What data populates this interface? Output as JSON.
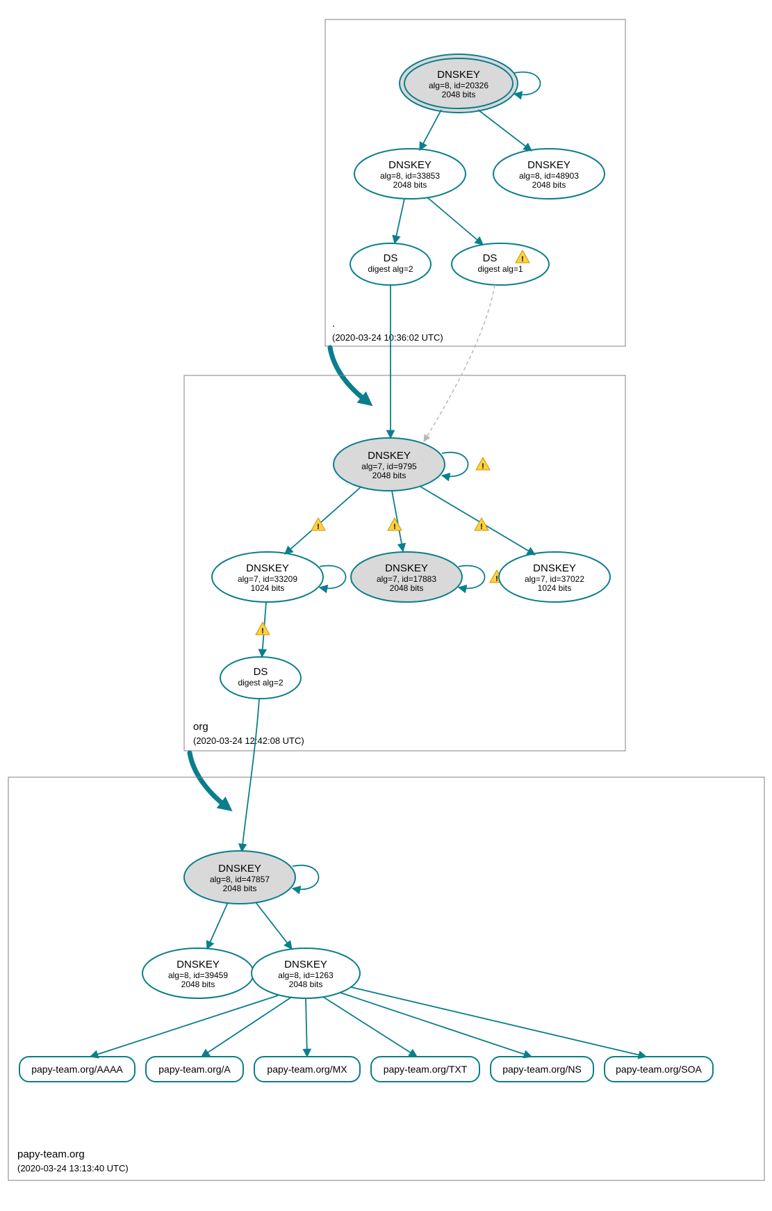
{
  "colors": {
    "teal": "#0a7e8c",
    "gray_fill": "#d9d9d9",
    "white": "#ffffff"
  },
  "zones": {
    "root": {
      "label": ".",
      "timestamp": "(2020-03-24 10:36:02 UTC)"
    },
    "org": {
      "label": "org",
      "timestamp": "(2020-03-24 12:42:08 UTC)"
    },
    "domain": {
      "label": "papy-team.org",
      "timestamp": "(2020-03-24 13:13:40 UTC)"
    }
  },
  "nodes": {
    "root_ksk": {
      "title": "DNSKEY",
      "line1": "alg=8, id=20326",
      "line2": "2048 bits"
    },
    "root_zsk1": {
      "title": "DNSKEY",
      "line1": "alg=8, id=33853",
      "line2": "2048 bits"
    },
    "root_zsk2": {
      "title": "DNSKEY",
      "line1": "alg=8, id=48903",
      "line2": "2048 bits"
    },
    "root_ds2": {
      "title": "DS",
      "line1": "digest alg=2"
    },
    "root_ds1": {
      "title": "DS",
      "line1": "digest alg=1"
    },
    "org_ksk": {
      "title": "DNSKEY",
      "line1": "alg=7, id=9795",
      "line2": "2048 bits"
    },
    "org_k1": {
      "title": "DNSKEY",
      "line1": "alg=7, id=33209",
      "line2": "1024 bits"
    },
    "org_k2": {
      "title": "DNSKEY",
      "line1": "alg=7, id=17883",
      "line2": "2048 bits"
    },
    "org_k3": {
      "title": "DNSKEY",
      "line1": "alg=7, id=37022",
      "line2": "1024 bits"
    },
    "org_ds": {
      "title": "DS",
      "line1": "digest alg=2"
    },
    "dom_ksk": {
      "title": "DNSKEY",
      "line1": "alg=8, id=47857",
      "line2": "2048 bits"
    },
    "dom_k1": {
      "title": "DNSKEY",
      "line1": "alg=8, id=39459",
      "line2": "2048 bits"
    },
    "dom_k2": {
      "title": "DNSKEY",
      "line1": "alg=8, id=1263",
      "line2": "2048 bits"
    }
  },
  "rrsets": {
    "aaaa": "papy-team.org/AAAA",
    "a": "papy-team.org/A",
    "mx": "papy-team.org/MX",
    "txt": "papy-team.org/TXT",
    "ns": "papy-team.org/NS",
    "soa": "papy-team.org/SOA"
  }
}
